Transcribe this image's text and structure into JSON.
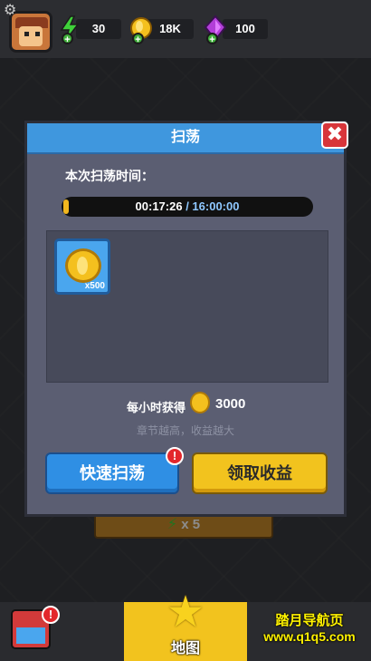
{
  "resources": {
    "energy": "30",
    "gold": "18K",
    "gems": "100"
  },
  "dialog": {
    "title": "扫荡",
    "time_label": "本次扫荡时间：",
    "time_current": "00:17:26",
    "time_separator": " / ",
    "time_total": "16:00:00",
    "progress_fraction": 0.018,
    "reward_item": {
      "icon": "gold-coin-icon",
      "count": "x500"
    },
    "hourly_label": "每小时获得",
    "hourly_value": "3000",
    "hint": "章节越高，收益越大",
    "fast_sweep_label": "快速扫荡",
    "claim_label": "领取收益",
    "close_glyph": "✖",
    "badge_glyph": "!"
  },
  "background": {
    "energy_button_label": "x 5"
  },
  "bottom_nav": {
    "map_label": "地图",
    "shop_badge": "!"
  },
  "watermark": {
    "line1": "踏月导航页",
    "line2": "www.q1q5.com"
  },
  "colors": {
    "header_blue": "#3f97de",
    "claim_yellow": "#f2c31e",
    "fast_blue": "#2f8fe4",
    "badge_red": "#e3272c"
  }
}
